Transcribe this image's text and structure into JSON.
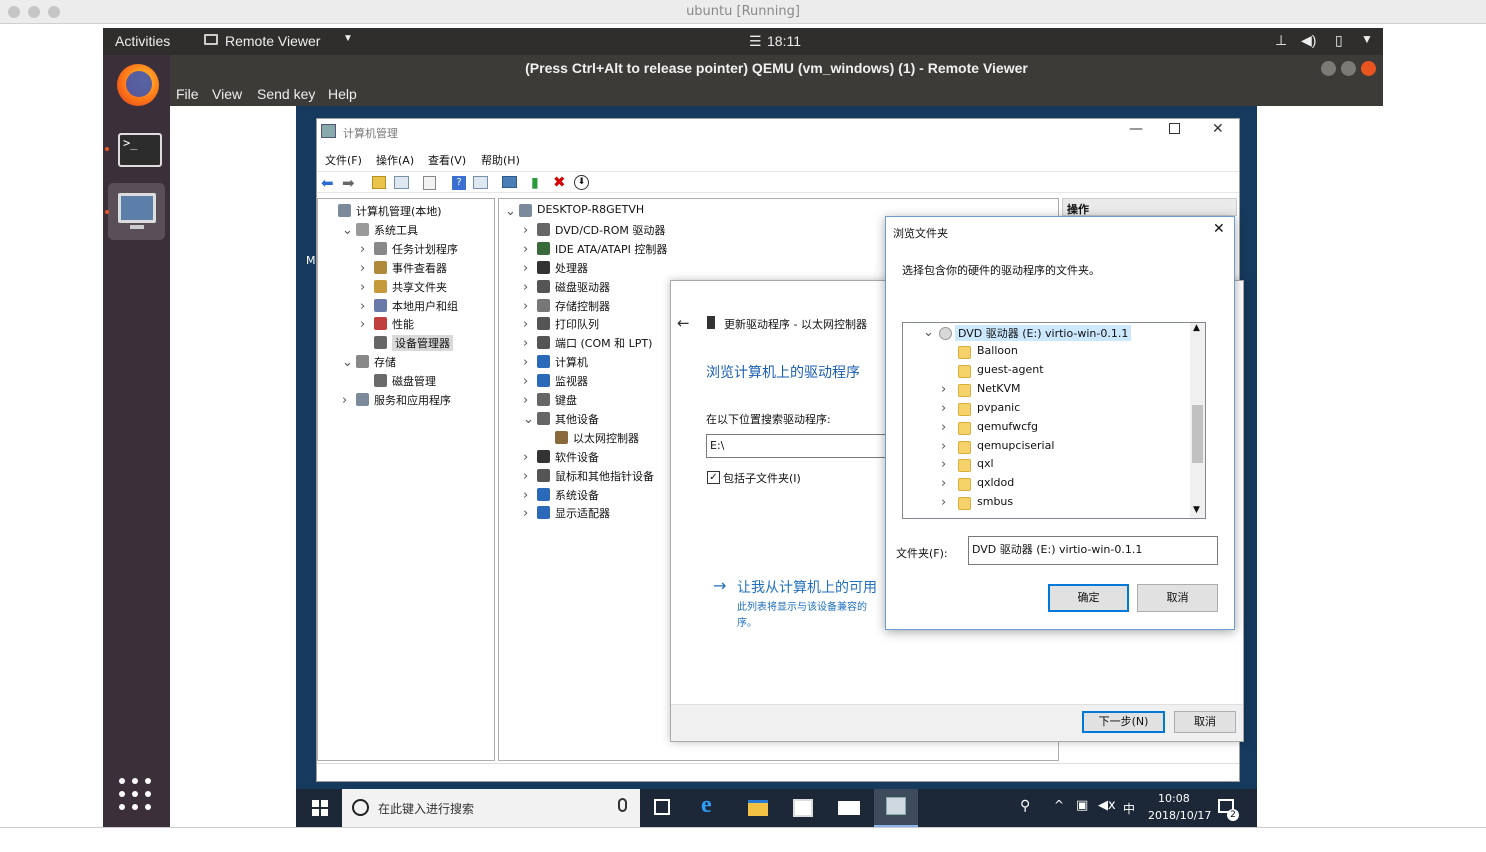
{
  "vbox": {
    "title": "ubuntu [Running]"
  },
  "topbar": {
    "activities": "Activities",
    "app_menu": "Remote Viewer",
    "clock": "18:11",
    "clock_prefix": "☰"
  },
  "remote_viewer": {
    "title": "(Press Ctrl+Alt to release pointer) QEMU (vm_windows) (1) - Remote Viewer",
    "menu": [
      "File",
      "View",
      "Send key",
      "Help"
    ]
  },
  "computer_management": {
    "title": "计算机管理",
    "menu": [
      "文件(F)",
      "操作(A)",
      "查看(V)",
      "帮助(H)"
    ],
    "left_tree": [
      {
        "label": "计算机管理(本地)",
        "level": 0,
        "expander": ""
      },
      {
        "label": "系统工具",
        "level": 1,
        "expander": "v"
      },
      {
        "label": "任务计划程序",
        "level": 2,
        "expander": ">"
      },
      {
        "label": "事件查看器",
        "level": 2,
        "expander": ">"
      },
      {
        "label": "共享文件夹",
        "level": 2,
        "expander": ">"
      },
      {
        "label": "本地用户和组",
        "level": 2,
        "expander": ">"
      },
      {
        "label": "性能",
        "level": 2,
        "expander": ">"
      },
      {
        "label": "设备管理器",
        "level": 2,
        "expander": "",
        "selected": true
      },
      {
        "label": "存储",
        "level": 1,
        "expander": "v"
      },
      {
        "label": "磁盘管理",
        "level": 2,
        "expander": ""
      },
      {
        "label": "服务和应用程序",
        "level": 1,
        "expander": ">"
      }
    ],
    "device_tree": [
      {
        "label": "DESKTOP-R8GETVH",
        "level": 0,
        "expander": "v"
      },
      {
        "label": "DVD/CD-ROM 驱动器",
        "level": 1,
        "expander": ">"
      },
      {
        "label": "IDE ATA/ATAPI 控制器",
        "level": 1,
        "expander": ">"
      },
      {
        "label": "处理器",
        "level": 1,
        "expander": ">"
      },
      {
        "label": "磁盘驱动器",
        "level": 1,
        "expander": ">"
      },
      {
        "label": "存储控制器",
        "level": 1,
        "expander": ">"
      },
      {
        "label": "打印队列",
        "level": 1,
        "expander": ">"
      },
      {
        "label": "端口 (COM 和 LPT)",
        "level": 1,
        "expander": ">"
      },
      {
        "label": "计算机",
        "level": 1,
        "expander": ">"
      },
      {
        "label": "监视器",
        "level": 1,
        "expander": ">"
      },
      {
        "label": "键盘",
        "level": 1,
        "expander": ">"
      },
      {
        "label": "其他设备",
        "level": 1,
        "expander": "v"
      },
      {
        "label": "以太网控制器",
        "level": 2,
        "expander": ""
      },
      {
        "label": "软件设备",
        "level": 1,
        "expander": ">"
      },
      {
        "label": "鼠标和其他指针设备",
        "level": 1,
        "expander": ">"
      },
      {
        "label": "系统设备",
        "level": 1,
        "expander": ">"
      },
      {
        "label": "显示适配器",
        "level": 1,
        "expander": ">"
      }
    ],
    "actions_header": "操作",
    "partial_letter": "M"
  },
  "update_driver": {
    "header": "更新驱动程序 - 以太网控制器",
    "heading": "浏览计算机上的驱动程序",
    "search_label": "在以下位置搜索驱动程序:",
    "path_value": "E:\\",
    "include_subfolders": "包括子文件夹(I)",
    "include_checked": true,
    "pick_link": "让我从计算机上的可用",
    "pick_desc_line1": "此列表将显示与该设备兼容的",
    "pick_desc_line2": "序。",
    "next_button": "下一步(N)",
    "cancel_button": "取消"
  },
  "browse_dialog": {
    "title": "浏览文件夹",
    "instruction": "选择包含你的硬件的驱动程序的文件夹。",
    "root": "DVD 驱动器 (E:) virtio-win-0.1.1",
    "folders": [
      {
        "name": "Balloon",
        "expander": ""
      },
      {
        "name": "guest-agent",
        "expander": ""
      },
      {
        "name": "NetKVM",
        "expander": ">"
      },
      {
        "name": "pvpanic",
        "expander": ">"
      },
      {
        "name": "qemufwcfg",
        "expander": ">"
      },
      {
        "name": "qemupciserial",
        "expander": ">"
      },
      {
        "name": "qxl",
        "expander": ">"
      },
      {
        "name": "qxldod",
        "expander": ">"
      },
      {
        "name": "smbus",
        "expander": ">"
      }
    ],
    "folder_label": "文件夹(F):",
    "folder_value": "DVD 驱动器 (E:) virtio-win-0.1.1",
    "ok_button": "确定",
    "cancel_button": "取消"
  },
  "taskbar": {
    "search_placeholder": "在此键入进行搜索",
    "ime": "中",
    "time": "10:08",
    "date": "2018/10/17",
    "notification_count": "2"
  },
  "colors": {
    "ubuntu_dock": "#3b2f3a",
    "ubuntu_topbar": "#2f2e2c",
    "win_accent": "#0078d7",
    "desktop": "#163a5e",
    "link": "#1f6fbf"
  }
}
